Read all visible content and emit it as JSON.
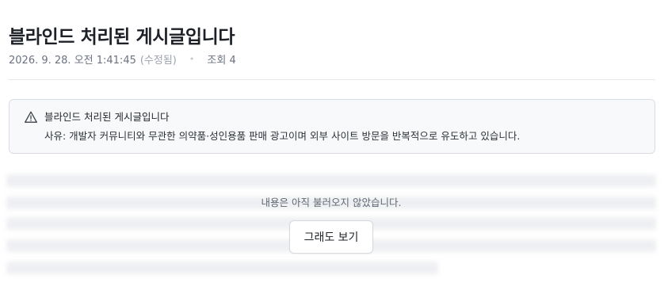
{
  "post": {
    "title": "블라인드 처리된 게시글입니다",
    "date": "2026. 9. 28. 오전 1:41:45",
    "edited_label": "(수정됨)",
    "separator": "•",
    "views_label": "조회 4"
  },
  "notice": {
    "icon": "warning-triangle-icon",
    "title": "블라인드 처리된 게시글입니다",
    "reason": "사유: 개발자 커뮤니티와 무관한 의약품·성인용품 판매 광고이며 외부 사이트 방문을 반복적으로 유도하고 있습니다."
  },
  "hidden_content": {
    "message": "내용은 아직 불러오지 않았습니다.",
    "show_button_label": "그래도 보기"
  },
  "colors": {
    "notice_bg": "#f8f9fb",
    "notice_border": "#d9dde3",
    "meta_text": "#6b7280",
    "title_text": "#1d2127"
  }
}
